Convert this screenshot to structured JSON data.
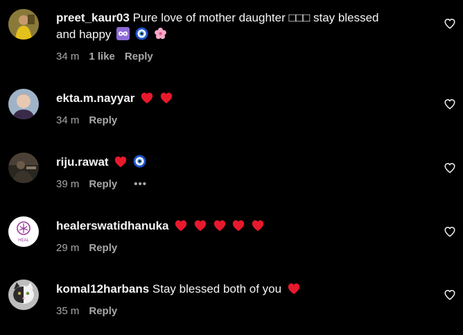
{
  "comments": [
    {
      "username": "preet_kaur03",
      "text": " Pure love of mother daughter □□□ stay blessed",
      "text_line2": "and happy",
      "time": "34 m",
      "likes": "1 like",
      "reply": "Reply",
      "avatar_icon": "avatar-photo"
    },
    {
      "username": "ekta.m.nayyar",
      "time": "34 m",
      "reply": "Reply",
      "avatar_icon": "avatar-photo"
    },
    {
      "username": "riju.rawat",
      "time": "39 m",
      "reply": "Reply",
      "more": "•••",
      "avatar_icon": "avatar-photo"
    },
    {
      "username": "healerswatidhanuka",
      "time": "29 m",
      "reply": "Reply",
      "avatar_logo_text": "HEAL",
      "avatar_icon": "avatar-logo"
    },
    {
      "username": "komal12harbans",
      "text": " Stay blessed both of you",
      "time": "35 m",
      "reply": "Reply",
      "avatar_icon": "avatar-cat-photo"
    }
  ],
  "colors": {
    "background": "#000000",
    "text": "#f5f5f5",
    "meta": "#a8a8a8",
    "heart": "#e8192c"
  }
}
